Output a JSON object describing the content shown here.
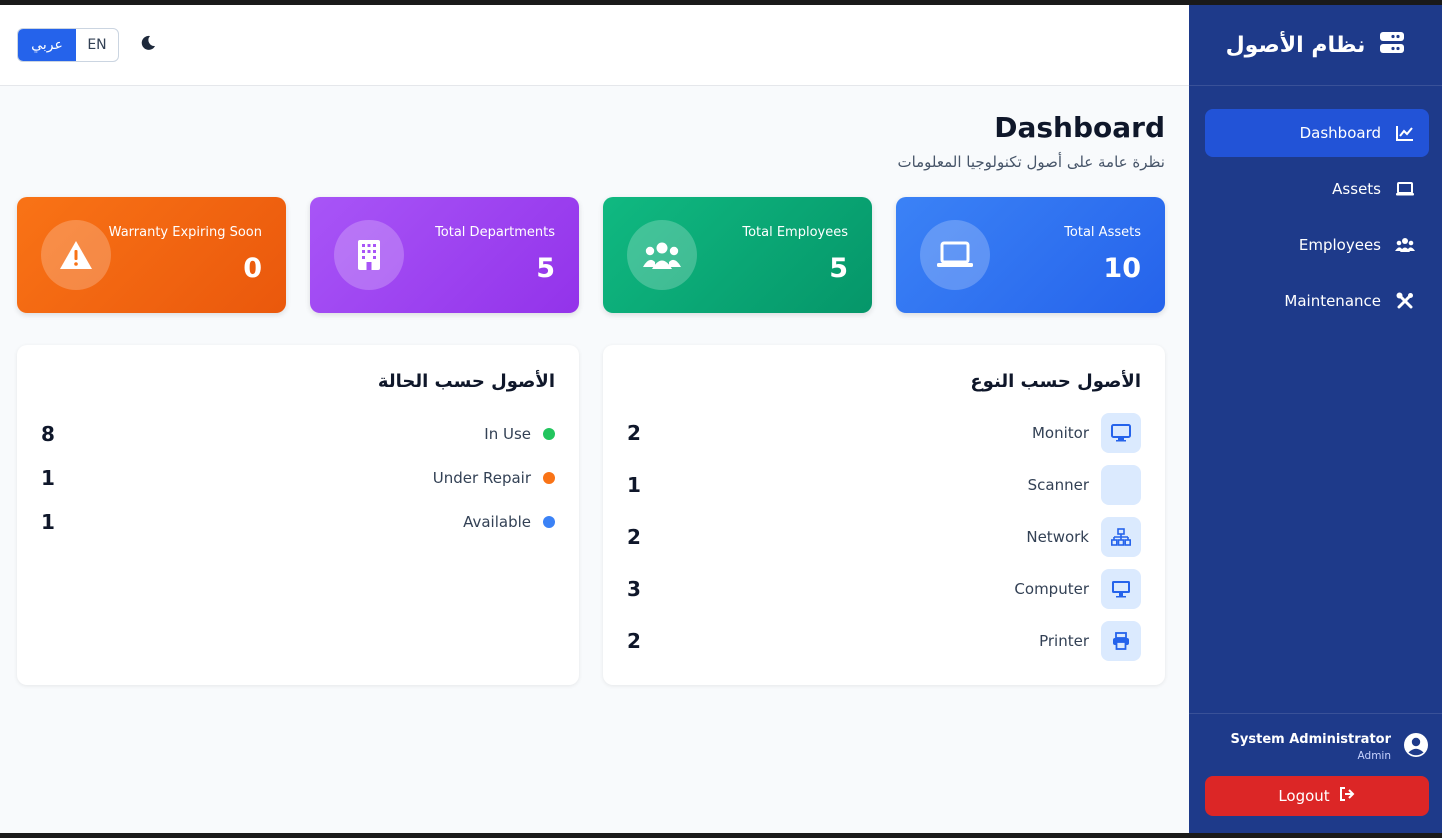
{
  "brand": {
    "title": "نظام الأصول",
    "icon": "server-icon"
  },
  "nav": [
    {
      "label": "Dashboard",
      "icon": "chart-line-icon",
      "active": true
    },
    {
      "label": "Assets",
      "icon": "laptop-icon",
      "active": false
    },
    {
      "label": "Employees",
      "icon": "users-icon",
      "active": false
    },
    {
      "label": "Maintenance",
      "icon": "tools-icon",
      "active": false
    }
  ],
  "user": {
    "name": "System Administrator",
    "role": "Admin",
    "logout_label": "Logout"
  },
  "topbar": {
    "lang_ar": "عربي",
    "lang_en": "EN",
    "active_lang": "ar"
  },
  "header": {
    "title": "Dashboard",
    "subtitle": "نظرة عامة على أصول تكنولوجيا المعلومات"
  },
  "stats": [
    {
      "id": "assets",
      "label": "Total Assets",
      "value": "10",
      "icon": "laptop-icon",
      "color": "#2563eb"
    },
    {
      "id": "employees",
      "label": "Total Employees",
      "value": "5",
      "icon": "users-icon",
      "color": "#059669"
    },
    {
      "id": "departments",
      "label": "Total Departments",
      "value": "5",
      "icon": "building-icon",
      "color": "#9333ea"
    },
    {
      "id": "warranty",
      "label": "Warranty Expiring Soon",
      "value": "0",
      "icon": "warning-icon",
      "color": "#ea580c"
    }
  ],
  "by_type": {
    "title": "الأصول حسب النوع",
    "rows": [
      {
        "name": "Monitor",
        "count": "2",
        "icon": "monitor-icon"
      },
      {
        "name": "Scanner",
        "count": "1",
        "icon": ""
      },
      {
        "name": "Network",
        "count": "2",
        "icon": "network-icon"
      },
      {
        "name": "Computer",
        "count": "3",
        "icon": "desktop-icon"
      },
      {
        "name": "Printer",
        "count": "2",
        "icon": "printer-icon"
      }
    ]
  },
  "by_status": {
    "title": "الأصول حسب الحالة",
    "rows": [
      {
        "name": "In Use",
        "count": "8",
        "color": "#22c55e"
      },
      {
        "name": "Under Repair",
        "count": "1",
        "color": "#f97316"
      },
      {
        "name": "Available",
        "count": "1",
        "color": "#3b82f6"
      }
    ]
  }
}
